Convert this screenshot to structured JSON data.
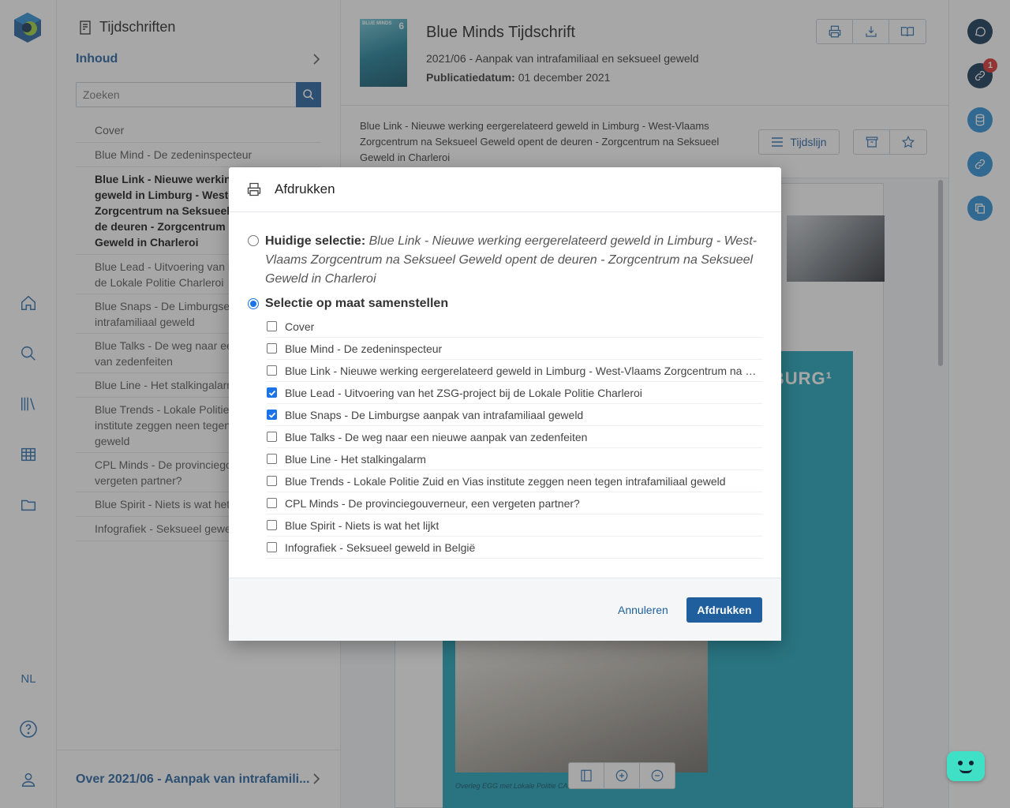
{
  "rail": {
    "language": "NL"
  },
  "toc": {
    "title": "Tijdschriften",
    "section": "Inhoud",
    "search_placeholder": "Zoeken",
    "items": [
      "Cover",
      "Blue Mind - De zedeninspecteur",
      "Blue Link - Nieuwe werking eergerelateerd geweld in Limburg - West-Vlaams Zorgcentrum na Seksueel Geweld opent de deuren - Zorgcentrum na Seksueel Geweld in Charleroi",
      "Blue Lead - Uitvoering van het ZSG-project bij de Lokale Politie Charleroi",
      "Blue Snaps - De Limburgse aanpak van intrafamiliaal geweld",
      "Blue Talks - De weg naar een nieuwe aanpak van zedenfeiten",
      "Blue Line - Het stalkingalarm",
      "Blue Trends - Lokale Politie Zuid en Vias institute zeggen neen tegen intrafamiliaal geweld",
      "CPL Minds - De provinciegouverneur, een vergeten partner?",
      "Blue Spirit - Niets is wat het lijkt",
      "Infografiek - Seksueel geweld in België"
    ],
    "footer": "Over 2021/06 - Aanpak van intrafamili..."
  },
  "magazine": {
    "title": "Blue Minds Tijdschrift",
    "issue": "2021/06 - Aanpak van intrafamiliaal en seksueel geweld",
    "date_label": "Publicatiedatum:",
    "date_value": "01 december 2021",
    "cover_text": "BLUE MINDS",
    "cover_number": "6"
  },
  "article": {
    "title": "Blue Link - Nieuwe werking eergerelateerd geweld in Limburg - West-Vlaams Zorgcentrum na Seksueel Geweld opent de deuren - Zorgcentrum na Seksueel Geweld in Charleroi",
    "timeline_label": "Tijdslijn",
    "page_heading": "MBURG¹",
    "photo_caption": "Overleg EGG met Lokale Politie CAR"
  },
  "modal": {
    "title": "Afdrukken",
    "current_label": "Huidige selectie:",
    "current_value": "Blue Link - Nieuwe werking eergerelateerd geweld in Limburg - West-Vlaams Zorgcentrum na Seksueel Geweld opent de deuren - Zorgcentrum na Seksueel Geweld in Charleroi",
    "custom_label": "Selectie op maat samenstellen",
    "items": [
      {
        "label": "Cover",
        "checked": false
      },
      {
        "label": "Blue Mind - De zedeninspecteur",
        "checked": false
      },
      {
        "label": "Blue Link - Nieuwe werking eergerelateerd geweld in Limburg - West-Vlaams Zorgcentrum na Seksueel...",
        "checked": false
      },
      {
        "label": "Blue Lead - Uitvoering van het ZSG-project bij de Lokale Politie Charleroi",
        "checked": true
      },
      {
        "label": "Blue Snaps - De Limburgse aanpak van intrafamiliaal geweld",
        "checked": true
      },
      {
        "label": "Blue Talks - De weg naar een nieuwe aanpak van zedenfeiten",
        "checked": false
      },
      {
        "label": "Blue Line - Het stalkingalarm",
        "checked": false
      },
      {
        "label": "Blue Trends - Lokale Politie Zuid en Vias institute zeggen neen tegen intrafamiliaal geweld",
        "checked": false
      },
      {
        "label": "CPL Minds - De provinciegouverneur, een vergeten partner?",
        "checked": false
      },
      {
        "label": "Blue Spirit - Niets is wat het lijkt",
        "checked": false
      },
      {
        "label": "Infografiek - Seksueel geweld in België",
        "checked": false
      }
    ],
    "cancel_label": "Annuleren",
    "print_label": "Afdrukken"
  },
  "right_rail": {
    "badge_count": "1"
  },
  "colors": {
    "brand_blue": "#1f5f9e",
    "dark_navy": "#0f3454",
    "teal": "#1aa3b8",
    "badge_red": "#d9312b"
  }
}
